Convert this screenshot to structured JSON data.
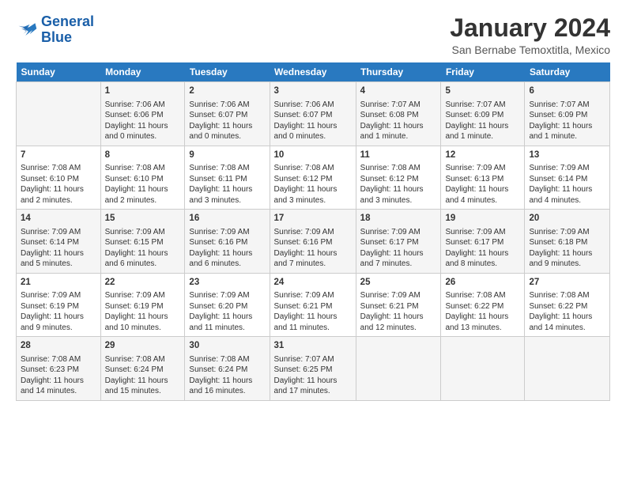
{
  "logo": {
    "line1": "General",
    "line2": "Blue"
  },
  "title": "January 2024",
  "subtitle": "San Bernabe Temoxtitla, Mexico",
  "weekdays": [
    "Sunday",
    "Monday",
    "Tuesday",
    "Wednesday",
    "Thursday",
    "Friday",
    "Saturday"
  ],
  "weeks": [
    [
      {
        "day": "",
        "text": ""
      },
      {
        "day": "1",
        "text": "Sunrise: 7:06 AM\nSunset: 6:06 PM\nDaylight: 11 hours\nand 0 minutes."
      },
      {
        "day": "2",
        "text": "Sunrise: 7:06 AM\nSunset: 6:07 PM\nDaylight: 11 hours\nand 0 minutes."
      },
      {
        "day": "3",
        "text": "Sunrise: 7:06 AM\nSunset: 6:07 PM\nDaylight: 11 hours\nand 0 minutes."
      },
      {
        "day": "4",
        "text": "Sunrise: 7:07 AM\nSunset: 6:08 PM\nDaylight: 11 hours\nand 1 minute."
      },
      {
        "day": "5",
        "text": "Sunrise: 7:07 AM\nSunset: 6:09 PM\nDaylight: 11 hours\nand 1 minute."
      },
      {
        "day": "6",
        "text": "Sunrise: 7:07 AM\nSunset: 6:09 PM\nDaylight: 11 hours\nand 1 minute."
      }
    ],
    [
      {
        "day": "7",
        "text": "Sunrise: 7:08 AM\nSunset: 6:10 PM\nDaylight: 11 hours\nand 2 minutes."
      },
      {
        "day": "8",
        "text": "Sunrise: 7:08 AM\nSunset: 6:10 PM\nDaylight: 11 hours\nand 2 minutes."
      },
      {
        "day": "9",
        "text": "Sunrise: 7:08 AM\nSunset: 6:11 PM\nDaylight: 11 hours\nand 3 minutes."
      },
      {
        "day": "10",
        "text": "Sunrise: 7:08 AM\nSunset: 6:12 PM\nDaylight: 11 hours\nand 3 minutes."
      },
      {
        "day": "11",
        "text": "Sunrise: 7:08 AM\nSunset: 6:12 PM\nDaylight: 11 hours\nand 3 minutes."
      },
      {
        "day": "12",
        "text": "Sunrise: 7:09 AM\nSunset: 6:13 PM\nDaylight: 11 hours\nand 4 minutes."
      },
      {
        "day": "13",
        "text": "Sunrise: 7:09 AM\nSunset: 6:14 PM\nDaylight: 11 hours\nand 4 minutes."
      }
    ],
    [
      {
        "day": "14",
        "text": "Sunrise: 7:09 AM\nSunset: 6:14 PM\nDaylight: 11 hours\nand 5 minutes."
      },
      {
        "day": "15",
        "text": "Sunrise: 7:09 AM\nSunset: 6:15 PM\nDaylight: 11 hours\nand 6 minutes."
      },
      {
        "day": "16",
        "text": "Sunrise: 7:09 AM\nSunset: 6:16 PM\nDaylight: 11 hours\nand 6 minutes."
      },
      {
        "day": "17",
        "text": "Sunrise: 7:09 AM\nSunset: 6:16 PM\nDaylight: 11 hours\nand 7 minutes."
      },
      {
        "day": "18",
        "text": "Sunrise: 7:09 AM\nSunset: 6:17 PM\nDaylight: 11 hours\nand 7 minutes."
      },
      {
        "day": "19",
        "text": "Sunrise: 7:09 AM\nSunset: 6:17 PM\nDaylight: 11 hours\nand 8 minutes."
      },
      {
        "day": "20",
        "text": "Sunrise: 7:09 AM\nSunset: 6:18 PM\nDaylight: 11 hours\nand 9 minutes."
      }
    ],
    [
      {
        "day": "21",
        "text": "Sunrise: 7:09 AM\nSunset: 6:19 PM\nDaylight: 11 hours\nand 9 minutes."
      },
      {
        "day": "22",
        "text": "Sunrise: 7:09 AM\nSunset: 6:19 PM\nDaylight: 11 hours\nand 10 minutes."
      },
      {
        "day": "23",
        "text": "Sunrise: 7:09 AM\nSunset: 6:20 PM\nDaylight: 11 hours\nand 11 minutes."
      },
      {
        "day": "24",
        "text": "Sunrise: 7:09 AM\nSunset: 6:21 PM\nDaylight: 11 hours\nand 11 minutes."
      },
      {
        "day": "25",
        "text": "Sunrise: 7:09 AM\nSunset: 6:21 PM\nDaylight: 11 hours\nand 12 minutes."
      },
      {
        "day": "26",
        "text": "Sunrise: 7:08 AM\nSunset: 6:22 PM\nDaylight: 11 hours\nand 13 minutes."
      },
      {
        "day": "27",
        "text": "Sunrise: 7:08 AM\nSunset: 6:22 PM\nDaylight: 11 hours\nand 14 minutes."
      }
    ],
    [
      {
        "day": "28",
        "text": "Sunrise: 7:08 AM\nSunset: 6:23 PM\nDaylight: 11 hours\nand 14 minutes."
      },
      {
        "day": "29",
        "text": "Sunrise: 7:08 AM\nSunset: 6:24 PM\nDaylight: 11 hours\nand 15 minutes."
      },
      {
        "day": "30",
        "text": "Sunrise: 7:08 AM\nSunset: 6:24 PM\nDaylight: 11 hours\nand 16 minutes."
      },
      {
        "day": "31",
        "text": "Sunrise: 7:07 AM\nSunset: 6:25 PM\nDaylight: 11 hours\nand 17 minutes."
      },
      {
        "day": "",
        "text": ""
      },
      {
        "day": "",
        "text": ""
      },
      {
        "day": "",
        "text": ""
      }
    ]
  ]
}
